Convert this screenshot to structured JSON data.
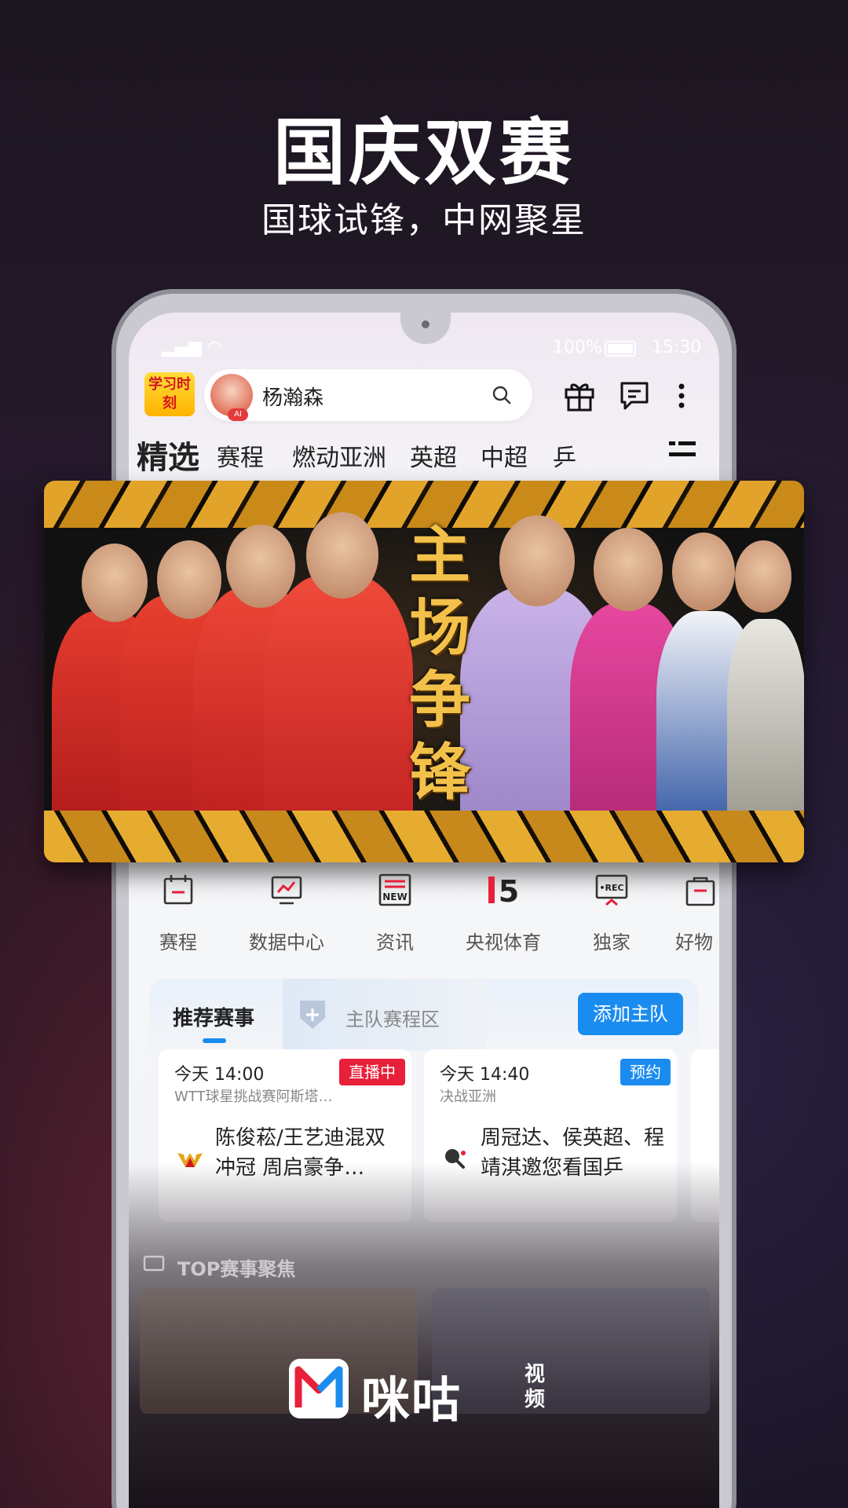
{
  "promo": {
    "title": "国庆双赛",
    "subtitle": "国球试锋，中网聚星"
  },
  "status_bar": {
    "battery": "100%",
    "time": "15:30"
  },
  "topbar": {
    "badge": "学习时刻",
    "avatar_badge": "AI",
    "search_text": "杨瀚森",
    "icons": [
      "search-icon",
      "gift-icon",
      "message-icon",
      "more-icon"
    ]
  },
  "tabs": [
    "精选",
    "赛程",
    "燃动亚洲",
    "英超",
    "中超",
    "乒"
  ],
  "banner": {
    "slogan": "主场争锋"
  },
  "quick_nav": [
    {
      "label": "赛程",
      "icon": "calendar-icon"
    },
    {
      "label": "数据中心",
      "icon": "chart-icon"
    },
    {
      "label": "资讯",
      "icon": "news-icon",
      "icon_text": "NEW"
    },
    {
      "label": "央视体育",
      "icon": "cctv5-icon",
      "icon_text": "5"
    },
    {
      "label": "独家",
      "icon": "rec-icon",
      "icon_text": "•REC"
    },
    {
      "label": "好物",
      "icon": "bag-icon"
    }
  ],
  "recommend": {
    "tab_active": "推荐赛事",
    "tab_other": "主队赛程区",
    "add_button": "添加主队",
    "matches": [
      {
        "time": "今天 14:00",
        "event": "WTT球星挑战赛阿斯塔…",
        "badge": "直播中",
        "badge_color": "#e8203a",
        "desc": "陈俊菘/王艺迪混双冲冠 周启豪争…"
      },
      {
        "time": "今天 14:40",
        "event": "决战亚洲",
        "badge": "预约",
        "badge_color": "#1a8cf0",
        "desc": "周冠达、侯英超、程靖淇邀您看国乒"
      }
    ]
  },
  "top_focus": {
    "title": "TOP赛事聚焦"
  },
  "brand": {
    "name": "咪咕",
    "sub": "视频"
  }
}
